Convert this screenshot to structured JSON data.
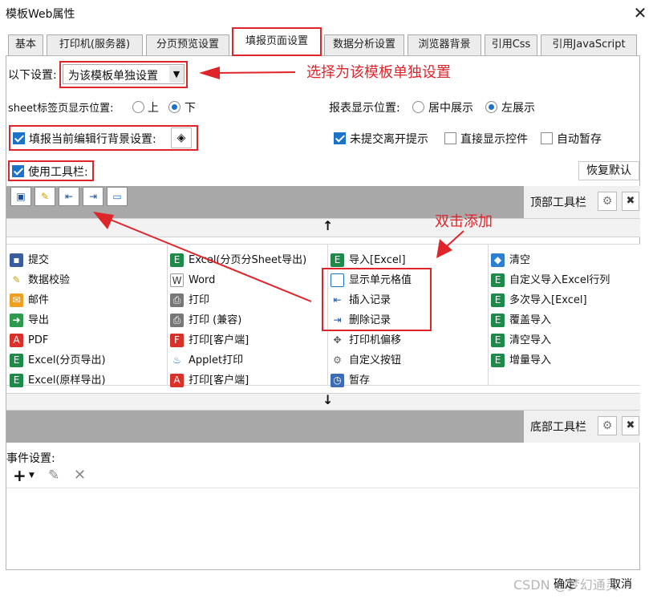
{
  "window": {
    "title": "模板Web属性",
    "close_glyph": "✕"
  },
  "tabs": [
    {
      "label": "基本"
    },
    {
      "label": "打印机(服务器)"
    },
    {
      "label": "分页预览设置"
    },
    {
      "label": "填报页面设置"
    },
    {
      "label": "数据分析设置"
    },
    {
      "label": "浏览器背景"
    },
    {
      "label": "引用Css"
    },
    {
      "label": "引用JavaScript"
    }
  ],
  "settings": {
    "scope_label": "以下设置:",
    "scope_value": "为该模板单独设置",
    "sheet_pos_label": "sheet标签页显示位置:",
    "sheet_pos_options": [
      "上",
      "下"
    ],
    "sheet_pos_selected": "下",
    "report_pos_label": "报表显示位置:",
    "report_pos_options": [
      "居中展示",
      "左展示"
    ],
    "report_pos_selected": "左展示",
    "edit_row_bg_label": "填报当前编辑行背景设置:",
    "leave_prompt_label": "未提交离开提示",
    "direct_show_label": "直接显示控件",
    "auto_save_label": "自动暂存",
    "use_toolbar_label": "使用工具栏:",
    "restore_default_label": "恢复默认"
  },
  "annotations": {
    "select_note": "选择为该模板单独设置",
    "dblclick_note": "双击添加"
  },
  "top_toolbar": {
    "label": "顶部工具栏"
  },
  "bottom_toolbar": {
    "label": "底部工具栏"
  },
  "items": [
    [
      "提交",
      "Excel(分页分Sheet导出)",
      "导入[Excel]",
      "清空"
    ],
    [
      "数据校验",
      "Word",
      "显示单元格值",
      "自定义导入Excel行列"
    ],
    [
      "邮件",
      "打印",
      "插入记录",
      "多次导入[Excel]"
    ],
    [
      "导出",
      "打印 (兼容)",
      "删除记录",
      "覆盖导入"
    ],
    [
      "PDF",
      "打印[客户端]",
      "打印机偏移",
      "清空导入"
    ],
    [
      "Excel(分页导出)",
      "Applet打印",
      "自定义按钮",
      "增量导入"
    ],
    [
      "Excel(原样导出)",
      "打印[客户端]",
      "暂存",
      ""
    ]
  ],
  "events": {
    "label": "事件设置:"
  },
  "footer": {
    "ok_label": "确定",
    "cancel_label": "取消",
    "watermark": "CSDN @梦幻通灵"
  },
  "colors": {
    "annotation_red": "#e0252a",
    "accent_blue": "#1a73c9",
    "toolbar_gray": "#a8a8a8"
  }
}
